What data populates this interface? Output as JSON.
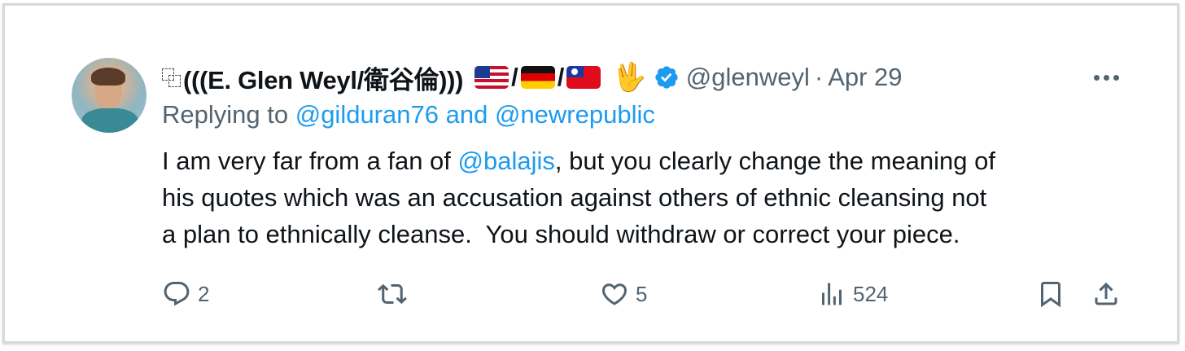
{
  "tweet": {
    "display_name": "(((E. Glen Weyl/衛谷倫)))",
    "name_prefix_icon": "overlapping-squares-icon",
    "flags": [
      "us-flag",
      "de-flag",
      "tw-flag"
    ],
    "separator": "/",
    "emoji": "🖖",
    "verified": true,
    "handle": "@glenweyl",
    "dot": "·",
    "date": "Apr 29",
    "replying_prefix": "Replying to",
    "replying_users": [
      "@gilduran76",
      "@newrepublic"
    ],
    "replying_and": "and",
    "body_line1_a": "I am very far from a fan of ",
    "body_mention": "@balajis",
    "body_line1_b": ", but you clearly change the meaning of",
    "body_line2": "his quotes which was an accusation against others of ethnic cleansing not",
    "body_line3": "a plan to ethnically cleanse.  You should withdraw or correct your piece.",
    "actions": {
      "reply_count": "2",
      "retweet_count": "",
      "like_count": "5",
      "view_count": "524"
    }
  },
  "colors": {
    "text": "#0f1419",
    "secondary": "#536471",
    "link": "#1d9bf0"
  }
}
